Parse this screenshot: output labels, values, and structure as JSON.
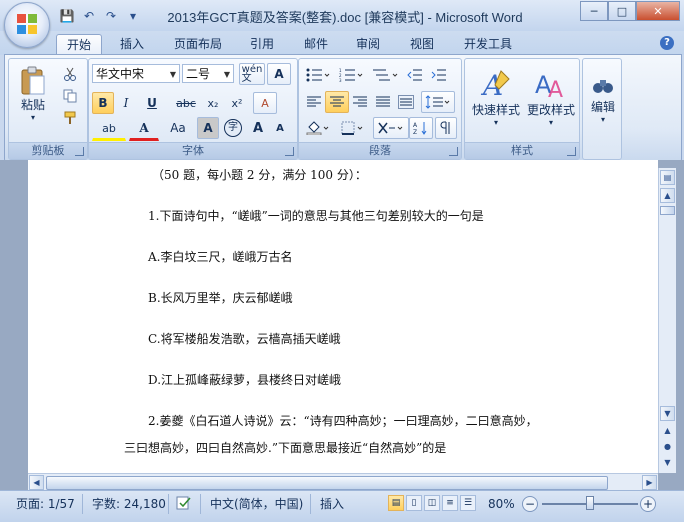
{
  "title_bar": {
    "title": "2013年GCT真题及答案(整套).doc [兼容模式] - Microsoft Word",
    "qat": {
      "save_glyph": "💾",
      "undo_glyph": "↶",
      "redo_glyph": "↷",
      "more_glyph": "▾"
    },
    "controls": {
      "minimize": "─",
      "maximize": "□",
      "close": "✕"
    }
  },
  "tabs": [
    {
      "label": "开始",
      "active": true
    },
    {
      "label": "插入"
    },
    {
      "label": "页面布局"
    },
    {
      "label": "引用"
    },
    {
      "label": "邮件"
    },
    {
      "label": "审阅"
    },
    {
      "label": "视图"
    },
    {
      "label": "开发工具"
    }
  ],
  "help_glyph": "?",
  "ribbon": {
    "clipboard": {
      "label": "剪贴板",
      "paste": "粘贴",
      "paste_arrow": "▾"
    },
    "font": {
      "label": "字体",
      "font_name": "华文中宋",
      "font_size": "二号",
      "phonetic": "wén\n文",
      "border_char": "A",
      "bold": "B",
      "italic": "I",
      "underline": "U",
      "strike": "abc",
      "subscript": "x₂",
      "superscript": "x²",
      "clear": "A",
      "highlight": "ab",
      "font_color": "A",
      "change_case": "Aa",
      "shading": "A",
      "enclose": "字",
      "grow": "A",
      "shrink": "A"
    },
    "paragraph": {
      "label": "段落"
    },
    "styles": {
      "label": "样式",
      "quick_styles": "快速样式",
      "change_styles": "更改样式"
    },
    "editing": {
      "label": "编辑"
    }
  },
  "document": {
    "lines": [
      "（50 题，每小题 2 分，满分 100 分）：",
      "1.下面诗句中，“嵯峨”一词的意思与其他三句差别较大的一句是",
      "A.李白坟三尺，嵯峨万古名",
      "B.长风万里举，庆云郁嵯峨",
      "C.将军楼船发浩歌，云樯高插天嵯峨",
      "D.江上孤峰蔽绿萝，县楼终日对嵯峨",
      "2.姜夔《白石道人诗说》云：“诗有四种高妙；一曰理高妙，二曰意高妙，",
      "三曰想高妙，四曰自然高妙.”下面意思最接近“自然高妙”的是"
    ]
  },
  "status_bar": {
    "page": "页面: 1/57",
    "words": "字数: 24,180",
    "language": "中文(简体，中国)",
    "mode": "插入",
    "zoom": "80%",
    "zoom_minus": "−",
    "zoom_plus": "+",
    "zoom_level_fraction": 0.5
  }
}
